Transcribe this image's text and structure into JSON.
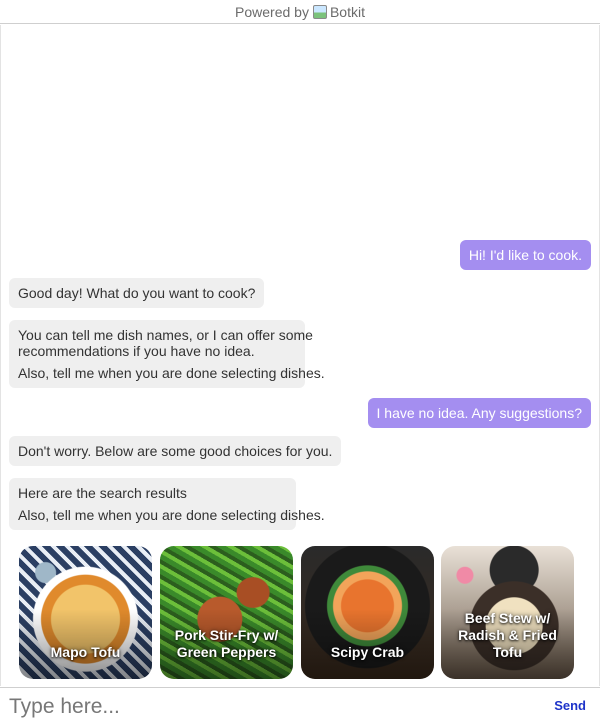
{
  "header": {
    "prefix": "Powered by",
    "brand": "Botkit"
  },
  "messages": [
    {
      "from": "user",
      "lines": [
        "Hi! I'd like to cook."
      ]
    },
    {
      "from": "bot",
      "lines": [
        "Good day! What do you want to cook?"
      ]
    },
    {
      "from": "bot",
      "lines": [
        "You can tell me dish names, or I can offer some",
        "recommendations if you have no idea.",
        "Also, tell me when you are done selecting dishes."
      ]
    },
    {
      "from": "user",
      "lines": [
        "I have no idea. Any suggestions?"
      ]
    },
    {
      "from": "bot",
      "lines": [
        "Don't worry. Below are some good choices for you."
      ]
    },
    {
      "from": "bot",
      "lines": [
        "Here are the search results",
        "Also, tell me when you are done selecting dishes."
      ]
    }
  ],
  "cards": [
    {
      "title": "Mapo Tofu",
      "image": "mapo-tofu-photo"
    },
    {
      "title": "Pork Stir-Fry w/ Green Peppers",
      "image": "pork-stir-fry-photo"
    },
    {
      "title": "Scipy Crab",
      "image": "spicy-crab-photo"
    },
    {
      "title": "Beef Stew w/ Radish & Fried Tofu",
      "image": "beef-stew-photo"
    }
  ],
  "input": {
    "placeholder": "Type here...",
    "value": "",
    "send_label": "Send"
  },
  "colors": {
    "user_bubble": "#a48ef0",
    "bot_bubble": "#efefef",
    "send_link": "#1d33c9"
  }
}
